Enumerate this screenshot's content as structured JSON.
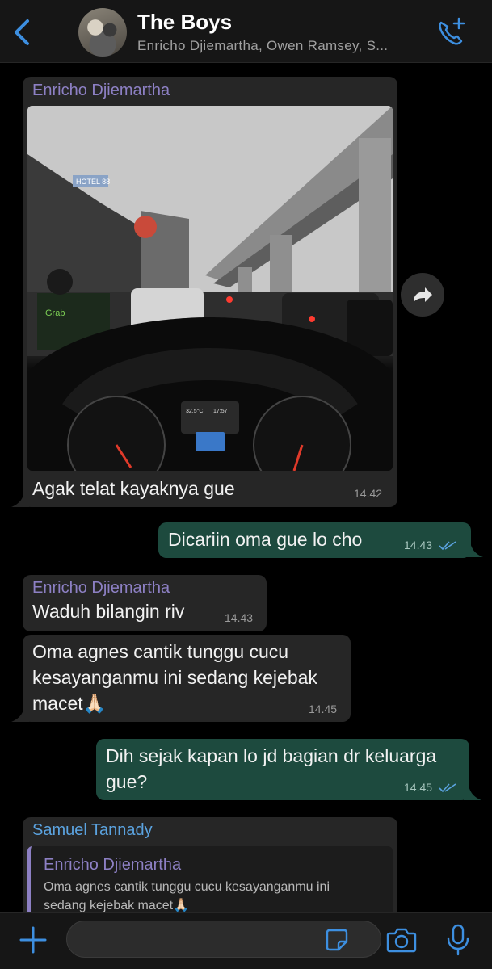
{
  "header": {
    "title": "The Boys",
    "subtitle": "Enricho Djiemartha, Owen Ramsey, S..."
  },
  "messages": [
    {
      "sender": "Enricho Djiemartha",
      "text": "Agak telat kayaknya gue",
      "time": "14.42",
      "image_caption": "Traffic on the road seen from a car dashboard",
      "direction": "incoming"
    },
    {
      "text": "Dicariin oma gue lo cho",
      "time": "14.43",
      "direction": "outgoing"
    },
    {
      "sender": "Enricho Djiemartha",
      "text": "Waduh bilangin riv",
      "time": "14.43",
      "direction": "incoming"
    },
    {
      "text_line1": "Oma agnes cantik tunggu cucu",
      "text_line2": "kesayanganmu ini sedang kejebak",
      "text_line3": "macet🙏🏻",
      "time": "14.45",
      "direction": "incoming"
    },
    {
      "text_line1": "Dih sejak kapan lo jd bagian dr keluarga",
      "text_line2": "gue?",
      "time": "14.45",
      "direction": "outgoing"
    },
    {
      "sender": "Samuel Tannady",
      "quote_sender": "Enricho Djiemartha",
      "quote_line1": "Oma agnes cantik tunggu cucu kesayanganmu ini",
      "quote_line2": "sedang kejebak macet🙏🏻",
      "direction": "incoming"
    }
  ],
  "photo_text": {
    "hotel_sign": "HOTEL 88",
    "brand": "Grab",
    "dash_temp": "32.5°C",
    "dash_clock": "17:57"
  },
  "colors": {
    "incoming_bubble": "#262626",
    "outgoing_bubble": "#1d4a3e",
    "sender_name": "#8d80c4",
    "accent_blue": "#3d8fe0"
  },
  "icons": [
    "chevron-left-icon",
    "phone-add-icon",
    "forward-icon",
    "plus-icon",
    "sticker-icon",
    "camera-icon",
    "mic-icon",
    "double-check-icon"
  ]
}
